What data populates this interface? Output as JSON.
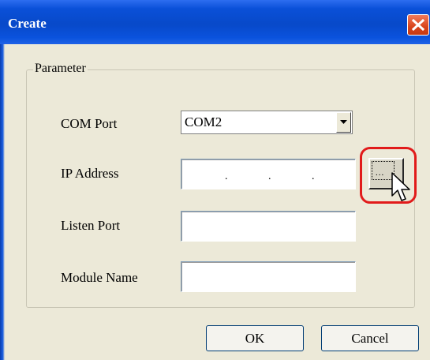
{
  "window": {
    "title": "Create",
    "close_icon": "close-icon"
  },
  "parameter_group": {
    "label": "Parameter",
    "com_port": {
      "label": "COM Port",
      "value": "COM2",
      "dropdown_icon": "chevron-down-icon"
    },
    "ip_address": {
      "label": "IP Address",
      "value": "   .   .   .",
      "browse_button_label": "...",
      "highlight_color": "#e11b1b"
    },
    "listen_port": {
      "label": "Listen Port",
      "value": ""
    },
    "module_name": {
      "label": "Module Name",
      "value": ""
    }
  },
  "buttons": {
    "ok_label": "OK",
    "cancel_label": "Cancel"
  },
  "colors": {
    "titlebar": "#0a50d8",
    "dialog_background": "#ece9d8",
    "close_button": "#d8441c"
  }
}
